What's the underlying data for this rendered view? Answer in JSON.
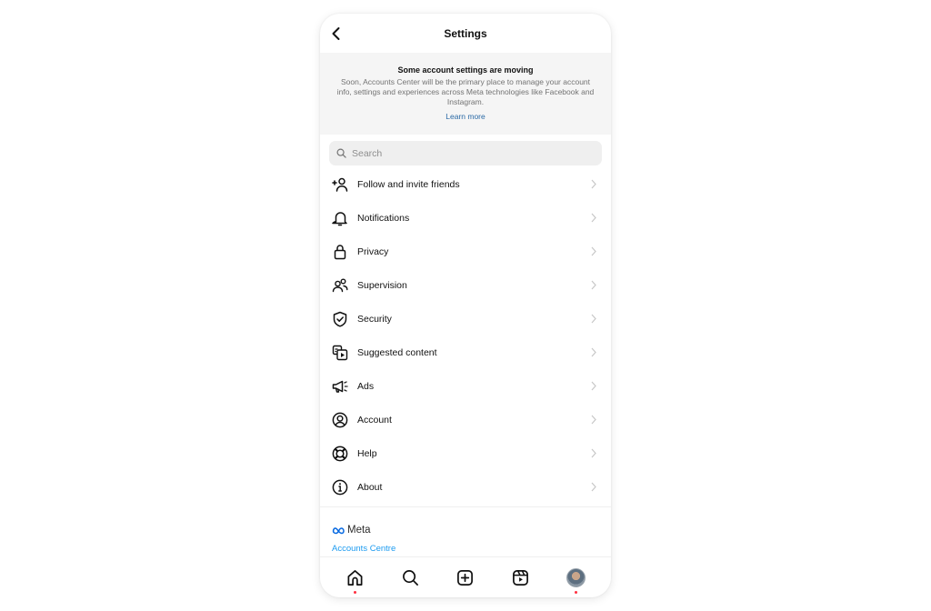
{
  "header": {
    "title": "Settings",
    "back_icon": "chevron-left-icon"
  },
  "notice": {
    "title": "Some account settings are moving",
    "body": "Soon, Accounts Center will be the primary place to manage your account info, settings and experiences across Meta technologies like Facebook and Instagram.",
    "link": "Learn more"
  },
  "search": {
    "placeholder": "Search",
    "value": ""
  },
  "menu": {
    "items": [
      {
        "label": "Follow and invite friends",
        "icon": "add-person-icon"
      },
      {
        "label": "Notifications",
        "icon": "bell-icon"
      },
      {
        "label": "Privacy",
        "icon": "lock-icon"
      },
      {
        "label": "Supervision",
        "icon": "people-icon"
      },
      {
        "label": "Security",
        "icon": "shield-check-icon"
      },
      {
        "label": "Suggested content",
        "icon": "suggested-content-icon"
      },
      {
        "label": "Ads",
        "icon": "megaphone-icon"
      },
      {
        "label": "Account",
        "icon": "account-circle-icon"
      },
      {
        "label": "Help",
        "icon": "lifebuoy-icon"
      },
      {
        "label": "About",
        "icon": "info-icon"
      }
    ]
  },
  "meta": {
    "brand": "Meta",
    "link": "Accounts Centre"
  },
  "bottom_nav": {
    "items": [
      {
        "name": "home",
        "icon": "home-icon",
        "badge": true
      },
      {
        "name": "search",
        "icon": "search-icon",
        "badge": false
      },
      {
        "name": "create",
        "icon": "plus-square-icon",
        "badge": false
      },
      {
        "name": "reels",
        "icon": "reels-icon",
        "badge": false
      },
      {
        "name": "profile",
        "icon": "avatar",
        "badge": true
      }
    ]
  },
  "colors": {
    "link": "#2b6aa6",
    "meta_link": "#1d9bf0",
    "badge": "#ff3040",
    "notice_bg": "#f5f5f5"
  }
}
